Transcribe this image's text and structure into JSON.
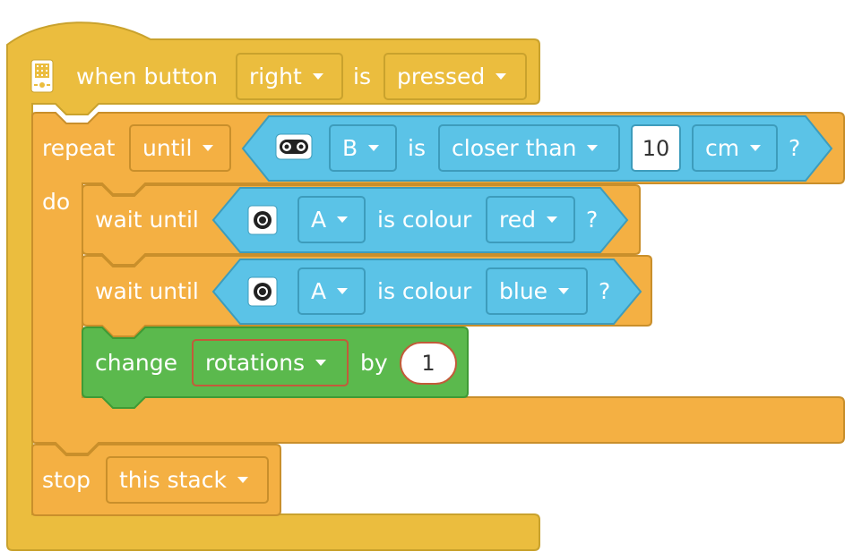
{
  "colors": {
    "hat_yellow": "#ebbd3e",
    "control_orange": "#f4b043",
    "sensor_blue": "#5bc3e7",
    "variable_green": "#5bb94d"
  },
  "hat": {
    "icon": "hub-icon",
    "label": "when button",
    "button_value": "right",
    "is_label": "is",
    "state_value": "pressed"
  },
  "repeat": {
    "label": "repeat",
    "mode_value": "until",
    "do_label": "do",
    "condition": {
      "icon": "distance-sensor-icon",
      "port": "B",
      "is_label": "is",
      "comparison": "closer than",
      "distance": "10",
      "unit": "cm",
      "question": "?"
    }
  },
  "wait1": {
    "label": "wait until",
    "icon": "color-sensor-icon",
    "port": "A",
    "is_colour_label": "is colour",
    "colour": "red",
    "question": "?"
  },
  "wait2": {
    "label": "wait until",
    "icon": "color-sensor-icon",
    "port": "A",
    "is_colour_label": "is colour",
    "colour": "blue",
    "question": "?"
  },
  "change": {
    "label": "change",
    "variable": "rotations",
    "by_label": "by",
    "amount": "1"
  },
  "stop": {
    "label": "stop",
    "target": "this stack"
  }
}
